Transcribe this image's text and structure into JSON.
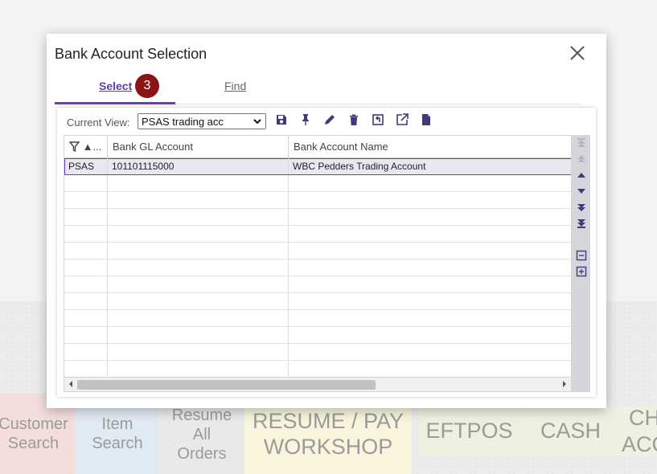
{
  "background": {
    "tiles": {
      "customer_search": "Customer\nSearch",
      "item_search": "Item\nSearch",
      "resume_all_orders": "Resume\nAll\nOrders",
      "resume_pay_workshop": "RESUME / PAY\nWORKSHOP",
      "eftpos": "EFTPOS",
      "cash": "CASH",
      "charge_account": "CH\nACC"
    }
  },
  "dialog": {
    "title": "Bank Account Selection",
    "tabs": {
      "select_label": "Select",
      "select_badge": "3",
      "find_label": "Find"
    },
    "toolbar": {
      "current_view_label": "Current View:",
      "current_view_value": "PSAS trading acc",
      "icons": [
        "save-icon",
        "pin-icon",
        "edit-icon",
        "delete-icon",
        "refresh-icon",
        "export-icon",
        "document-icon"
      ]
    },
    "grid": {
      "columns": {
        "filter_sort": "▲...",
        "bank_gl_account": "Bank GL Account",
        "bank_account_name": "Bank Account Name"
      },
      "rows": [
        {
          "code": "PSAS",
          "gl_account": "101101115000",
          "account_name": "WBC Pedders Trading Account"
        }
      ],
      "empty_rows": 12,
      "selected_row": 0,
      "horizontal_scroll_fraction": 0.6
    },
    "side_controls": [
      "first-page-icon",
      "previous-page-icon",
      "move-up-icon",
      "move-down-icon",
      "next-page-icon",
      "last-page-icon",
      "collapse-icon",
      "expand-icon"
    ]
  },
  "colors": {
    "accent": "#6a3ec2",
    "badge": "#8b1414",
    "selected_row": "#ebe7f1",
    "toolbar_icon": "#3e3c78"
  }
}
